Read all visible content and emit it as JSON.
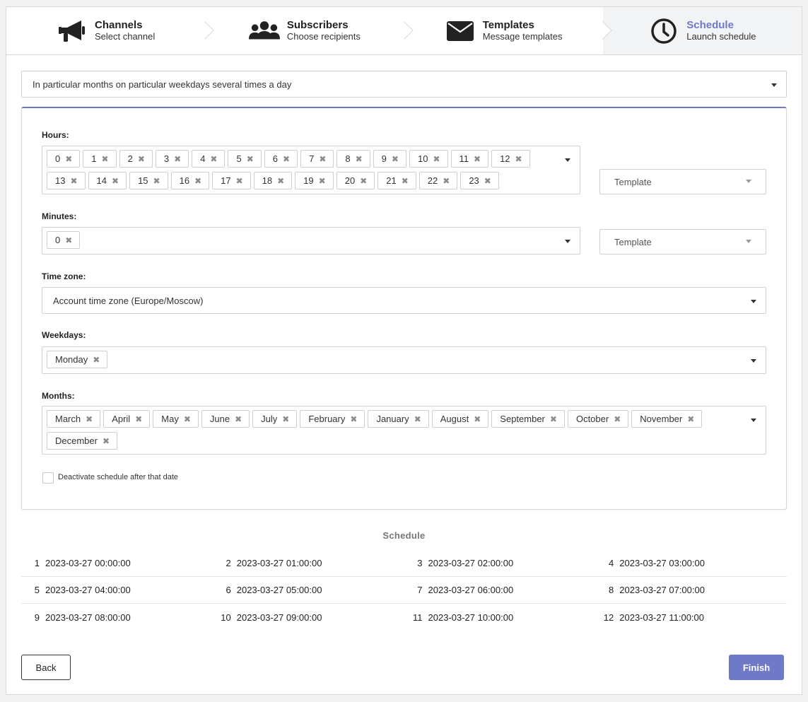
{
  "steps": [
    {
      "title": "Channels",
      "subtitle": "Select channel",
      "icon": "megaphone-icon"
    },
    {
      "title": "Subscribers",
      "subtitle": "Choose recipients",
      "icon": "users-icon"
    },
    {
      "title": "Templates",
      "subtitle": "Message templates",
      "icon": "envelope-icon"
    },
    {
      "title": "Schedule",
      "subtitle": "Launch schedule",
      "icon": "clock-icon"
    }
  ],
  "schedule_type": {
    "value": "In particular months on particular weekdays several times a day"
  },
  "hours": {
    "label": "Hours:",
    "tags": [
      "0",
      "1",
      "2",
      "3",
      "4",
      "5",
      "6",
      "7",
      "8",
      "9",
      "10",
      "11",
      "12",
      "13",
      "14",
      "15",
      "16",
      "17",
      "18",
      "19",
      "20",
      "21",
      "22",
      "23"
    ],
    "template_placeholder": "Template"
  },
  "minutes": {
    "label": "Minutes:",
    "tags": [
      "0"
    ],
    "template_placeholder": "Template"
  },
  "timezone": {
    "label": "Time zone:",
    "value": "Account time zone (Europe/Moscow)"
  },
  "weekdays": {
    "label": "Weekdays:",
    "tags": [
      "Monday"
    ]
  },
  "months": {
    "label": "Months:",
    "tags": [
      "March",
      "April",
      "May",
      "June",
      "July",
      "February",
      "January",
      "August",
      "September",
      "October",
      "November",
      "December"
    ]
  },
  "deactivate": {
    "label": "Deactivate schedule after that date",
    "checked": false
  },
  "schedule": {
    "title": "Schedule",
    "rows": [
      [
        {
          "n": "1",
          "t": "2023-03-27 00:00:00"
        },
        {
          "n": "2",
          "t": "2023-03-27 01:00:00"
        },
        {
          "n": "3",
          "t": "2023-03-27 02:00:00"
        },
        {
          "n": "4",
          "t": "2023-03-27 03:00:00"
        }
      ],
      [
        {
          "n": "5",
          "t": "2023-03-27 04:00:00"
        },
        {
          "n": "6",
          "t": "2023-03-27 05:00:00"
        },
        {
          "n": "7",
          "t": "2023-03-27 06:00:00"
        },
        {
          "n": "8",
          "t": "2023-03-27 07:00:00"
        }
      ],
      [
        {
          "n": "9",
          "t": "2023-03-27 08:00:00"
        },
        {
          "n": "10",
          "t": "2023-03-27 09:00:00"
        },
        {
          "n": "11",
          "t": "2023-03-27 10:00:00"
        },
        {
          "n": "12",
          "t": "2023-03-27 11:00:00"
        }
      ]
    ]
  },
  "buttons": {
    "back": "Back",
    "finish": "Finish"
  },
  "colors": {
    "accent": "#6e79c7",
    "tag_remove": "#8a8a8a",
    "active_step_bg": "#f2f3f5"
  }
}
